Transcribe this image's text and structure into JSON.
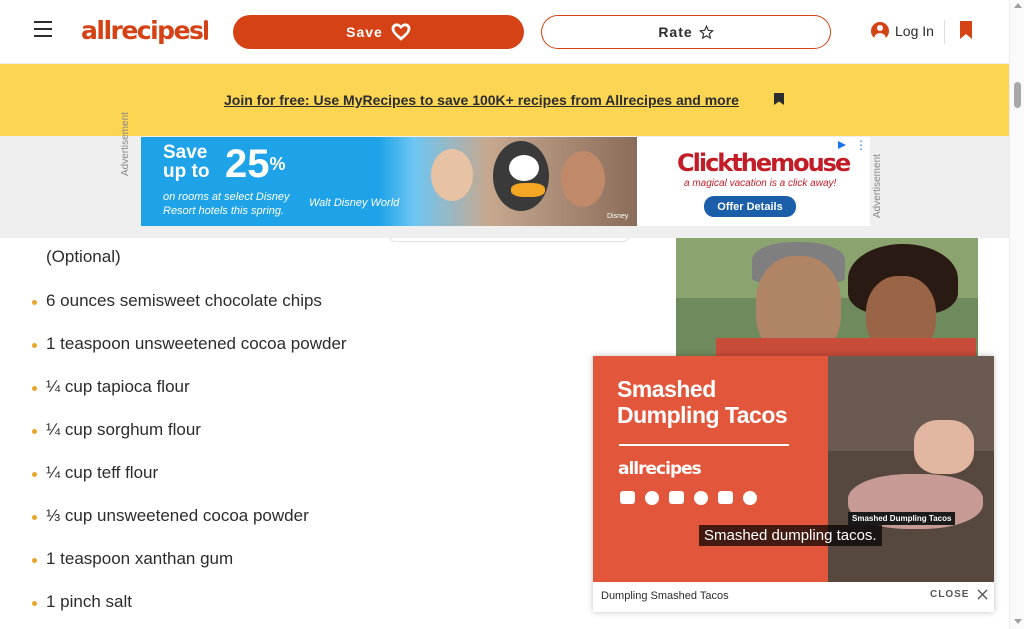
{
  "header": {
    "logo_text": "allrecipes",
    "save_label": "Save",
    "rate_label": "Rate",
    "login_label": "Log In"
  },
  "promo": {
    "link_text": "Join for free: Use MyRecipes to save 100K+ recipes from Allrecipes and more"
  },
  "ad_banner": {
    "side_label": "Advertisement",
    "headline_save": "Save up to",
    "headline_percent": "25",
    "headline_percent_sign": "%",
    "fine_print": "on rooms at select Disney Resort hotels this spring.",
    "wdw_text": "Walt Disney World",
    "disclaimer": "Disney",
    "brand": "Clickthemouse",
    "tagline": "a magical vacation is a click away!",
    "offer_label": "Offer Details"
  },
  "ingredients": {
    "partial_item": "(Optional)",
    "items": [
      "6 ounces semisweet chocolate chips",
      "1 teaspoon unsweetened cocoa powder",
      "¼ cup tapioca flour",
      "¼ cup sorghum flour",
      "¼ cup teff flour",
      "⅓ cup unsweetened cocoa powder",
      "1 teaspoon xanthan gum",
      "1 pinch salt"
    ]
  },
  "video": {
    "title_line1": "Smashed",
    "title_line2": "Dumpling Tacos",
    "logo_text": "allrecipes",
    "image_label": "Smashed Dumpling Tacos",
    "caption": "Smashed dumpling tacos.",
    "name": "Dumpling Smashed Tacos",
    "close_label": "CLOSE"
  },
  "colors": {
    "brand": "#d54215",
    "promo_bg": "#fcd653",
    "ad_blue": "#1fa3e8",
    "video_bg": "#e2573c",
    "bullet": "#e8a62c"
  }
}
